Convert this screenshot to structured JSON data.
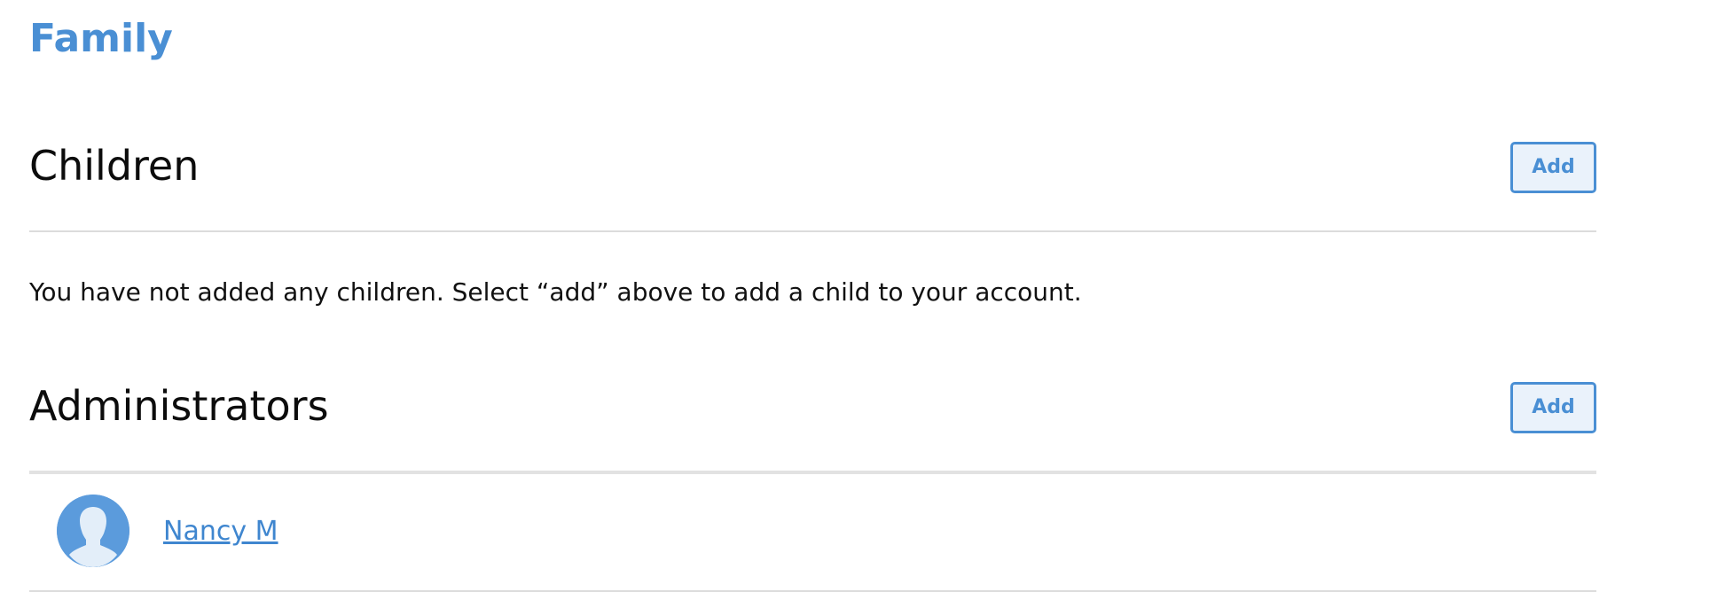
{
  "page": {
    "title": "Family"
  },
  "children_section": {
    "title": "Children",
    "add_label": "Add",
    "empty_message": "You have not added any children. Select “add” above to add a child to your account."
  },
  "administrators_section": {
    "title": "Administrators",
    "add_label": "Add",
    "members": [
      {
        "name": "Nancy M",
        "avatar_icon": "person-silhouette-icon"
      }
    ]
  },
  "colors": {
    "accent": "#4a8fd4",
    "button_fill": "#eaf2fb",
    "avatar_bg": "#5b9bdc",
    "divider": "#dcdcdc"
  }
}
